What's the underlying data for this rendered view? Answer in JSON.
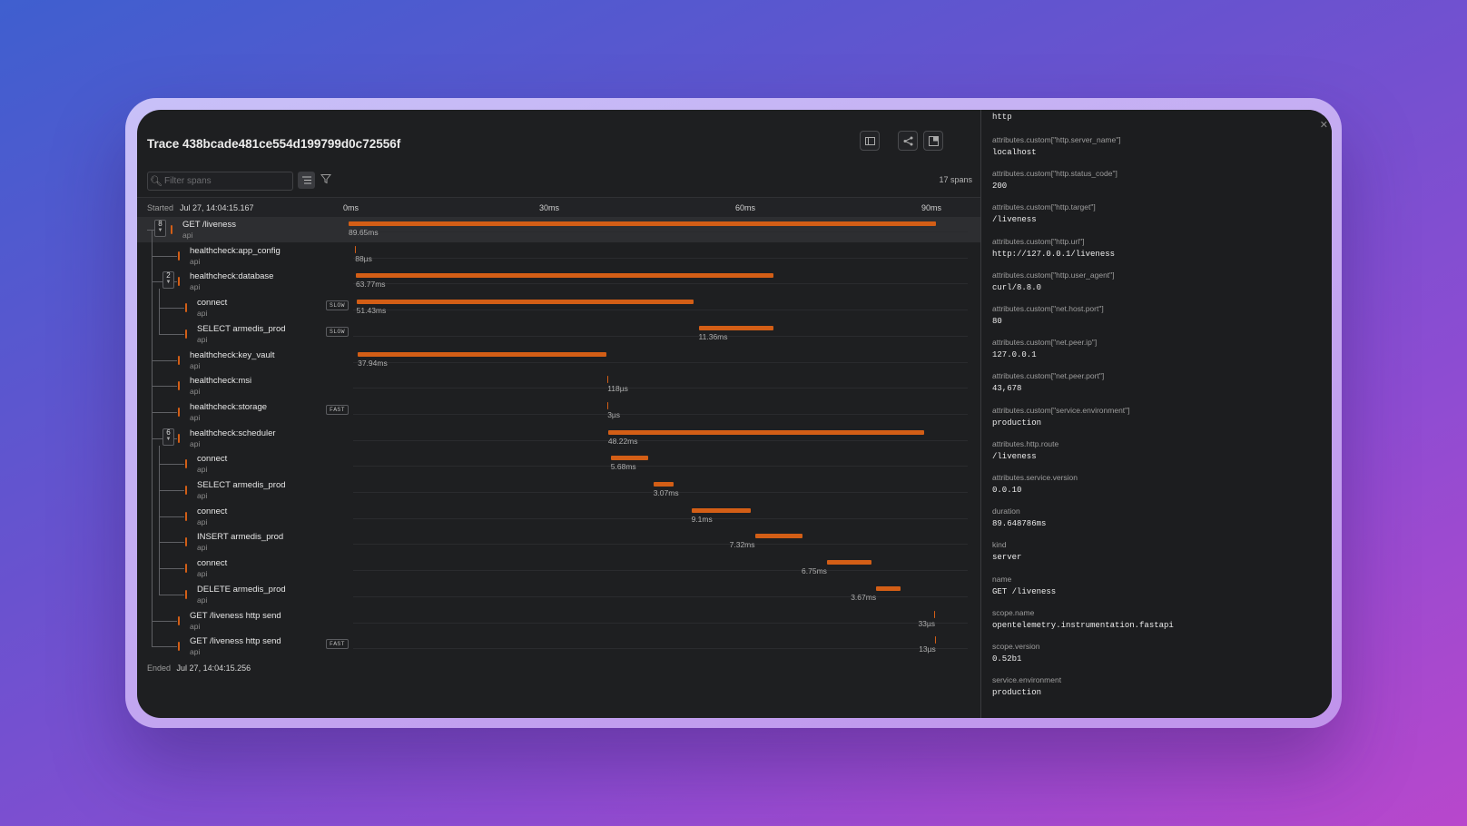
{
  "trace": {
    "title": "Trace 438bcade481ce554d199799d0c72556f",
    "filter_placeholder": "Filter spans",
    "spans_count": "17 spans",
    "started_label": "Started",
    "started_value": "Jul 27, 14:04:15.167",
    "ended_label": "Ended",
    "ended_value": "Jul 27, 14:04:15.256",
    "ticks": [
      "0ms",
      "30ms",
      "60ms",
      "90ms"
    ],
    "accent_color": "#d35e16"
  },
  "spans": [
    {
      "name": "GET /liveness",
      "service": "api",
      "duration": "89.65ms",
      "depth": 0,
      "children": "8",
      "start_ms": 0,
      "dur_ms": 89.65
    },
    {
      "name": "healthcheck:app_config",
      "service": "api",
      "duration": "88µs",
      "depth": 1,
      "start_ms": 1.0,
      "dur_ms": 0.088
    },
    {
      "name": "healthcheck:database",
      "service": "api",
      "duration": "63.77ms",
      "depth": 1,
      "children": "2",
      "start_ms": 1.1,
      "dur_ms": 63.77
    },
    {
      "name": "connect",
      "service": "api",
      "duration": "51.43ms",
      "depth": 2,
      "badge": "SLOW",
      "start_ms": 1.2,
      "dur_ms": 51.43
    },
    {
      "name": "SELECT armedis_prod",
      "service": "api",
      "duration": "11.36ms",
      "depth": 2,
      "badge": "SLOW",
      "start_ms": 53.4,
      "dur_ms": 11.36
    },
    {
      "name": "healthcheck:key_vault",
      "service": "api",
      "duration": "37.94ms",
      "depth": 1,
      "start_ms": 1.4,
      "dur_ms": 37.94
    },
    {
      "name": "healthcheck:msi",
      "service": "api",
      "duration": "118µs",
      "depth": 1,
      "start_ms": 39.5,
      "dur_ms": 0.118
    },
    {
      "name": "healthcheck:storage",
      "service": "api",
      "duration": "3µs",
      "depth": 1,
      "badge": "FAST",
      "start_ms": 39.5,
      "dur_ms": 0.003
    },
    {
      "name": "healthcheck:scheduler",
      "service": "api",
      "duration": "48.22ms",
      "depth": 1,
      "children": "6",
      "start_ms": 39.6,
      "dur_ms": 48.22
    },
    {
      "name": "connect",
      "service": "api",
      "duration": "5.68ms",
      "depth": 2,
      "start_ms": 40.0,
      "dur_ms": 5.68
    },
    {
      "name": "SELECT armedis_prod",
      "service": "api",
      "duration": "3.07ms",
      "depth": 2,
      "start_ms": 46.5,
      "dur_ms": 3.07
    },
    {
      "name": "connect",
      "service": "api",
      "duration": "9.1ms",
      "depth": 2,
      "start_ms": 52.3,
      "dur_ms": 9.1
    },
    {
      "name": "INSERT armedis_prod",
      "service": "api",
      "duration": "7.32ms",
      "depth": 2,
      "start_ms": 62.0,
      "dur_ms": 7.32
    },
    {
      "name": "connect",
      "service": "api",
      "duration": "6.75ms",
      "depth": 2,
      "start_ms": 73.0,
      "dur_ms": 6.75
    },
    {
      "name": "DELETE armedis_prod",
      "service": "api",
      "duration": "3.67ms",
      "depth": 2,
      "start_ms": 80.5,
      "dur_ms": 3.67
    },
    {
      "name": "GET /liveness http send",
      "service": "api",
      "duration": "33µs",
      "depth": 1,
      "start_ms": 89.4,
      "dur_ms": 0.033
    },
    {
      "name": "GET /liveness http send",
      "service": "api",
      "duration": "13µs",
      "depth": 1,
      "badge": "FAST",
      "start_ms": 89.5,
      "dur_ms": 0.013
    }
  ],
  "attributes": {
    "top_value": "http",
    "items": [
      {
        "key": "attributes.custom[\"http.server_name\"]",
        "value": "localhost"
      },
      {
        "key": "attributes.custom[\"http.status_code\"]",
        "value": "200"
      },
      {
        "key": "attributes.custom[\"http.target\"]",
        "value": "/liveness"
      },
      {
        "key": "attributes.custom[\"http.url\"]",
        "value": "http://127.0.0.1/liveness"
      },
      {
        "key": "attributes.custom[\"http.user_agent\"]",
        "value": "curl/8.8.0"
      },
      {
        "key": "attributes.custom[\"net.host.port\"]",
        "value": "80"
      },
      {
        "key": "attributes.custom[\"net.peer.ip\"]",
        "value": "127.0.0.1"
      },
      {
        "key": "attributes.custom[\"net.peer.port\"]",
        "value": "43,678"
      },
      {
        "key": "attributes.custom[\"service.environment\"]",
        "value": "production"
      },
      {
        "key": "attributes.http.route",
        "value": "/liveness"
      },
      {
        "key": "attributes.service.version",
        "value": "0.0.10"
      },
      {
        "key": "duration",
        "value": "89.648786ms"
      },
      {
        "key": "kind",
        "value": "server"
      },
      {
        "key": "name",
        "value": "GET /liveness"
      },
      {
        "key": "scope.name",
        "value": "opentelemetry.instrumentation.fastapi"
      },
      {
        "key": "scope.version",
        "value": "0.52b1"
      },
      {
        "key": "service.environment",
        "value": "production"
      }
    ]
  },
  "icons": {
    "search": "search-icon",
    "list": "list-view-icon",
    "filter": "filter-icon",
    "panel": "panel-icon",
    "share": "share-icon",
    "expand": "expand-icon",
    "close": "close-icon"
  }
}
